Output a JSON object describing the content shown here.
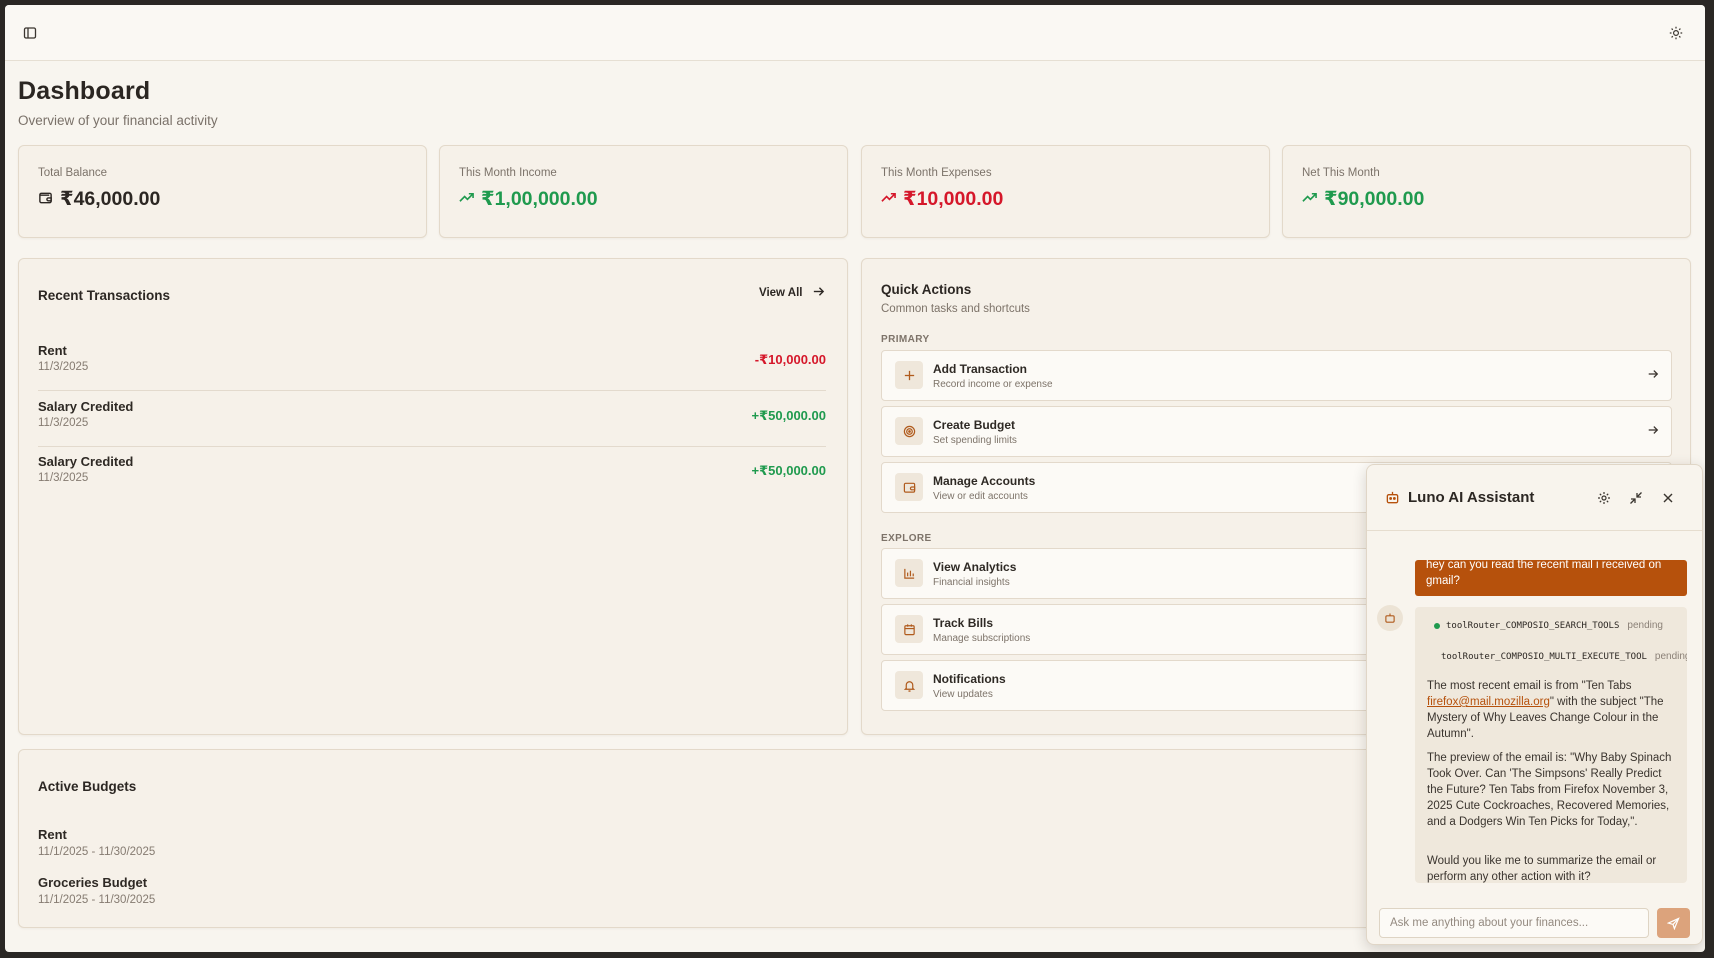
{
  "header": {
    "sidebar_toggle_icon": "sidebar-toggle-icon",
    "theme_icon": "sun-icon"
  },
  "page": {
    "title": "Dashboard",
    "subtitle": "Overview of your financial activity"
  },
  "stats": [
    {
      "label": "Total Balance",
      "value": "₹46,000.00",
      "icon": "wallet-icon",
      "color": "#2c2723"
    },
    {
      "label": "This Month Income",
      "value": "₹1,00,000.00",
      "icon": "trending-up-icon",
      "color": "#1f9a4e"
    },
    {
      "label": "This Month Expenses",
      "value": "₹10,000.00",
      "icon": "trending-up-icon",
      "color": "#d5172a"
    },
    {
      "label": "Net This Month",
      "value": "₹90,000.00",
      "icon": "trending-up-icon",
      "color": "#1f9a4e"
    }
  ],
  "transactions": {
    "title": "Recent Transactions",
    "view_all": "View All",
    "items": [
      {
        "name": "Rent",
        "date": "11/3/2025",
        "amount": "-₹10,000.00"
      },
      {
        "name": "Salary Credited",
        "date": "11/3/2025",
        "amount": "+₹50,000.00"
      },
      {
        "name": "Salary Credited",
        "date": "11/3/2025",
        "amount": "+₹50,000.00"
      }
    ]
  },
  "quick_actions": {
    "title": "Quick Actions",
    "subtitle": "Common tasks and shortcuts",
    "primary_label": "PRIMARY",
    "explore_label": "EXPLORE",
    "items": [
      {
        "title": "Add Transaction",
        "sub": "Record income or expense",
        "icon": "plus-icon"
      },
      {
        "title": "Create Budget",
        "sub": "Set spending limits",
        "icon": "target-icon"
      },
      {
        "title": "Manage Accounts",
        "sub": "View or edit accounts",
        "icon": "wallet-icon"
      },
      {
        "title": "View Analytics",
        "sub": "Financial insights",
        "icon": "bar-chart-icon"
      },
      {
        "title": "Track Bills",
        "sub": "Manage subscriptions",
        "icon": "calendar-icon"
      },
      {
        "title": "Notifications",
        "sub": "View updates",
        "icon": "bell-icon"
      }
    ]
  },
  "budgets": {
    "title": "Active Budgets",
    "items": [
      {
        "name": "Rent",
        "range": "11/1/2025 - 11/30/2025"
      },
      {
        "name": "Groceries Budget",
        "range": "11/1/2025 - 11/30/2025"
      }
    ]
  },
  "assistant": {
    "title": "Luno AI Assistant",
    "user_message": "hey can you read the recent mail i received on gmail?",
    "tool_calls": [
      {
        "name": "toolRouter_COMPOSIO_SEARCH_TOOLS",
        "status": "pending"
      },
      {
        "name": "toolRouter_COMPOSIO_MULTI_EXECUTE_TOOL",
        "status": "pending"
      }
    ],
    "reply_1_pre": "The most recent email is from \"Ten Tabs",
    "reply_1_link": "firefox@mail.mozilla.org",
    "reply_1_post": "\" with the subject \"The Mystery of Why Leaves Change Colour in the Autumn\".",
    "reply_2": "The preview of the email is: \"Why Baby Spinach Took Over. Can 'The Simpsons' Really Predict the Future? Ten Tabs from Firefox November 3, 2025 Cute Cockroaches, Recovered Memories, and a Dodgers Win Ten Picks for Today,\".",
    "reply_3": "Would you like me to summarize the email or perform any other action with it?",
    "input_placeholder": "Ask me anything about your finances..."
  }
}
